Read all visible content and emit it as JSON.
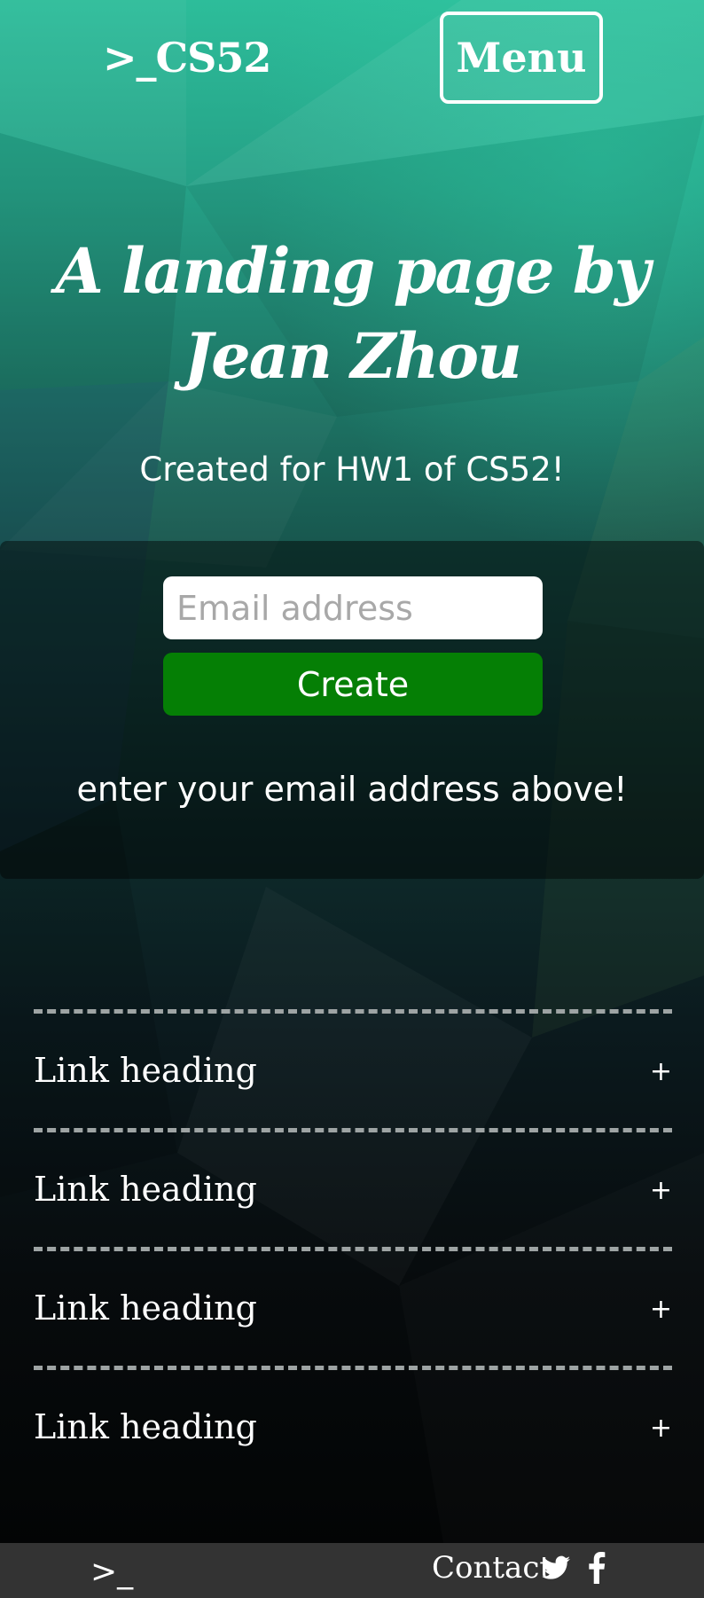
{
  "nav": {
    "brand": ">_CS52",
    "menu_label": "Menu"
  },
  "hero": {
    "title": "A landing page by Jean Zhou",
    "subtitle": "Created for HW1 of CS52!"
  },
  "signup": {
    "email_placeholder": "Email address",
    "email_value": "",
    "create_label": "Create",
    "hint": "enter your email address above!"
  },
  "links": {
    "items": [
      {
        "label": "Link heading",
        "toggle": "+"
      },
      {
        "label": "Link heading",
        "toggle": "+"
      },
      {
        "label": "Link heading",
        "toggle": "+"
      },
      {
        "label": "Link heading",
        "toggle": "+"
      }
    ]
  },
  "footer": {
    "logo": ">_",
    "contact_label": "Contact",
    "social_icons": [
      "twitter-icon",
      "facebook-icon"
    ]
  },
  "colors": {
    "accent_teal": "#2dbd9a",
    "create_button": "#057f05",
    "footer_bg": "#333333",
    "divider": "#9ea4a4"
  }
}
